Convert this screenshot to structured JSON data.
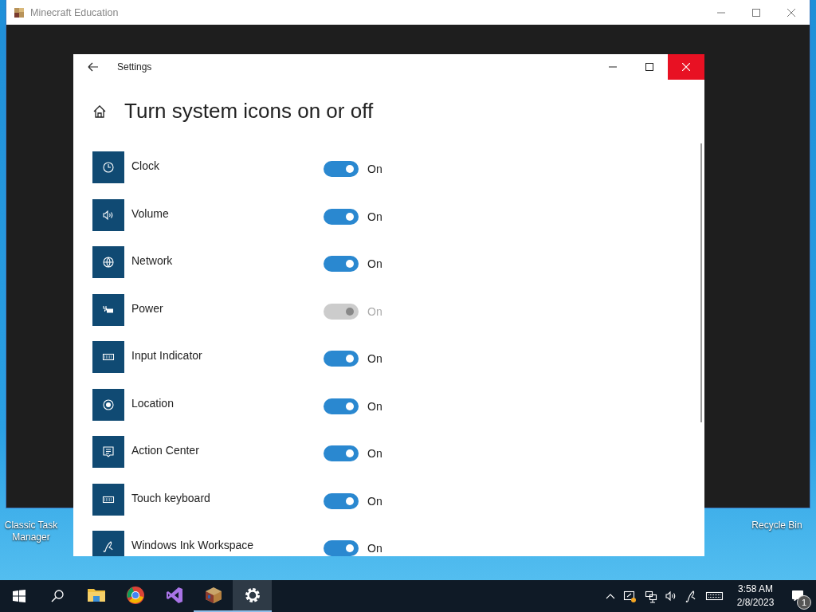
{
  "desktop": {
    "icons": [
      {
        "label": "Classic Task Manager"
      },
      {
        "label": "Recycle Bin"
      }
    ]
  },
  "app_window": {
    "title": "Minecraft Education"
  },
  "settings": {
    "title": "Settings",
    "heading": "Turn system icons on or off",
    "items": [
      {
        "kind": "clock",
        "label": "Clock",
        "on": true,
        "disabled": false,
        "state": "On"
      },
      {
        "kind": "volume",
        "label": "Volume",
        "on": true,
        "disabled": false,
        "state": "On"
      },
      {
        "kind": "network",
        "label": "Network",
        "on": true,
        "disabled": false,
        "state": "On"
      },
      {
        "kind": "power",
        "label": "Power",
        "on": true,
        "disabled": true,
        "state": "On"
      },
      {
        "kind": "keyboard",
        "label": "Input Indicator",
        "on": true,
        "disabled": false,
        "state": "On"
      },
      {
        "kind": "location",
        "label": "Location",
        "on": true,
        "disabled": false,
        "state": "On"
      },
      {
        "kind": "message",
        "label": "Action Center",
        "on": true,
        "disabled": false,
        "state": "On"
      },
      {
        "kind": "keyboard",
        "label": "Touch keyboard",
        "on": true,
        "disabled": false,
        "state": "On"
      },
      {
        "kind": "pen",
        "label": "Windows Ink Workspace",
        "on": true,
        "disabled": false,
        "state": "On"
      }
    ]
  },
  "taskbar": {
    "apps": [
      {
        "kind": "folder",
        "running": false,
        "selected": false
      },
      {
        "kind": "browser",
        "running": false,
        "selected": false
      },
      {
        "kind": "studio",
        "running": false,
        "selected": false
      },
      {
        "kind": "cube",
        "running": true,
        "selected": false
      },
      {
        "kind": "gear",
        "running": true,
        "selected": true
      }
    ],
    "time": "3:58 AM",
    "date": "2/8/2023",
    "notification_count": "1"
  }
}
